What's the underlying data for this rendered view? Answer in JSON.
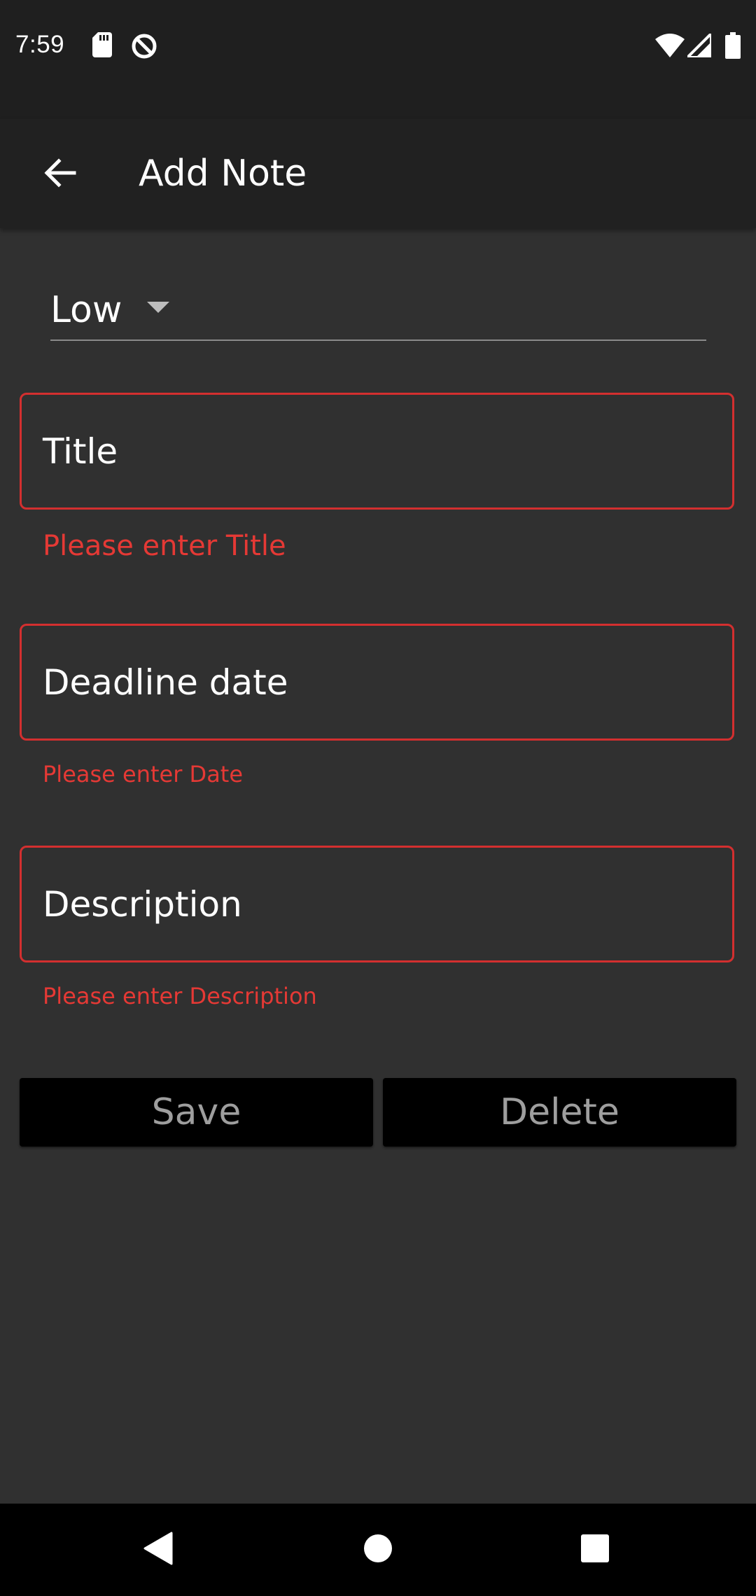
{
  "status_bar": {
    "time": "7:59",
    "left_icons": [
      "sd-card-icon",
      "data-saver-icon"
    ],
    "right_icons": [
      "wifi-icon",
      "cell-signal-icon",
      "battery-icon"
    ]
  },
  "app_bar": {
    "title": "Add Note",
    "back_icon": "arrow-back-icon"
  },
  "priority": {
    "selected": "Low"
  },
  "form": {
    "title": {
      "label": "Title",
      "error": "Please enter Title"
    },
    "deadline": {
      "label": "Deadline date",
      "error": "Please enter Date"
    },
    "description": {
      "label": "Description",
      "error": "Please enter Description"
    }
  },
  "buttons": {
    "save": "Save",
    "delete": "Delete"
  },
  "nav_bar": {
    "icons": [
      "nav-back-icon",
      "nav-home-icon",
      "nav-recents-icon"
    ]
  },
  "colors": {
    "background": "#303030",
    "app_bar": "#212121",
    "error": "#d32f2f",
    "button_bg": "#000000",
    "button_text": "#9e9e9e"
  }
}
